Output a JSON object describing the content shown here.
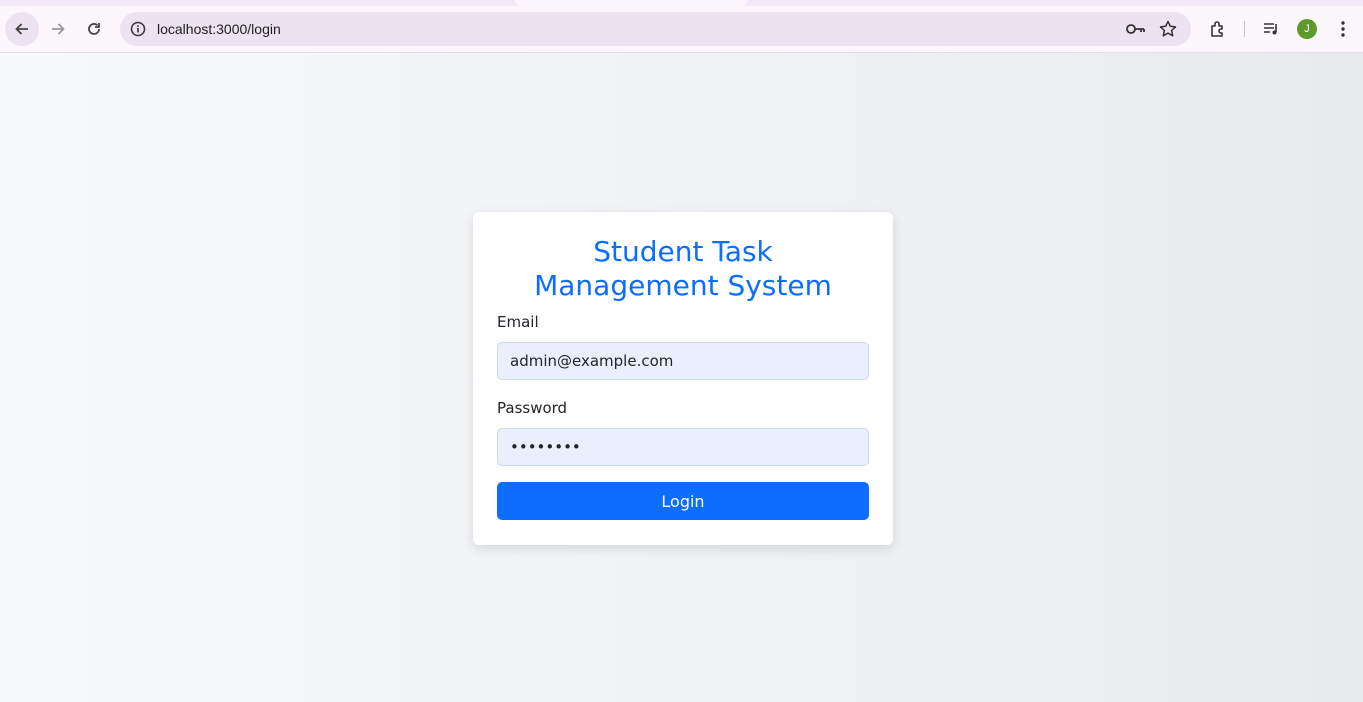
{
  "browser": {
    "url": "localhost:3000/login",
    "profile_initial": "J"
  },
  "login": {
    "title": "Student Task Management System",
    "email_label": "Email",
    "email_value": "admin@example.com",
    "password_label": "Password",
    "password_value": "12345678",
    "login_button": "Login"
  },
  "colors": {
    "accent": "#0d6efd",
    "input_bg": "#e8f0fe",
    "avatar": "#5e9a2c"
  },
  "icons": [
    "back-arrow-icon",
    "forward-arrow-icon",
    "reload-icon",
    "site-info-icon",
    "password-key-icon",
    "bookmark-star-icon",
    "extensions-icon",
    "media-control-icon",
    "kebab-menu-icon"
  ]
}
